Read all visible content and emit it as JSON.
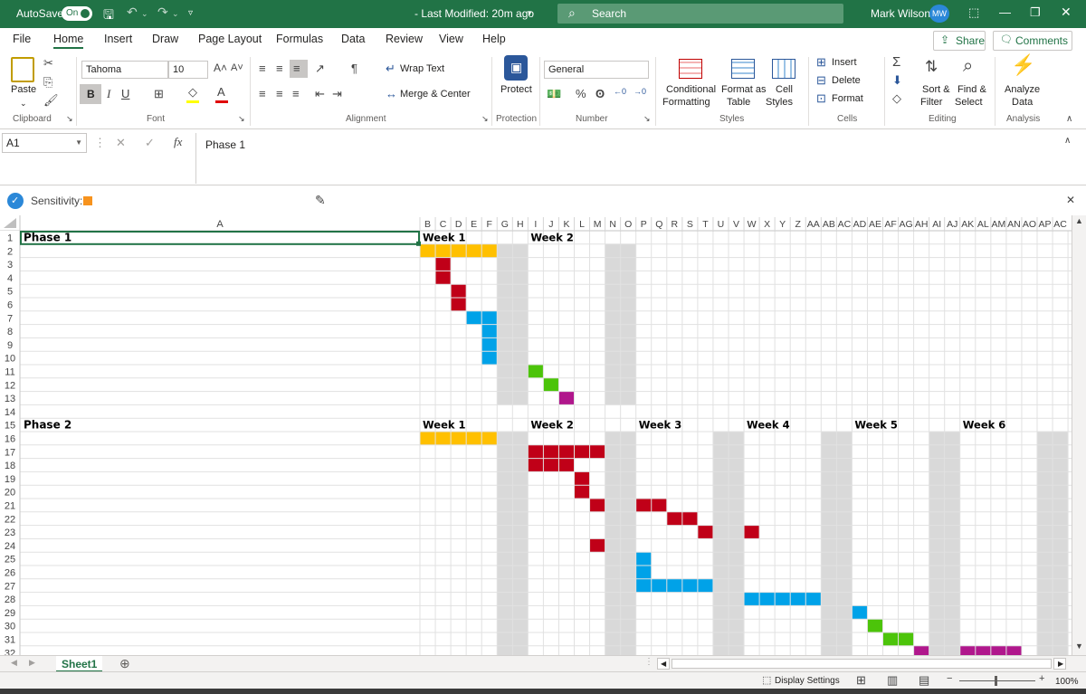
{
  "titlebar": {
    "autosave_label": "AutoSave",
    "autosave_state": "On",
    "doc_status": "- Last Modified: 20m ago",
    "search_placeholder": "Search",
    "user_name": "Mark Wilson",
    "user_initials": "MW"
  },
  "tabs": [
    "File",
    "Home",
    "Insert",
    "Draw",
    "Page Layout",
    "Formulas",
    "Data",
    "Review",
    "View",
    "Help"
  ],
  "active_tab": "Home",
  "share_label": "Share",
  "comments_label": "Comments",
  "ribbon": {
    "paste_label": "Paste",
    "clipboard_label": "Clipboard",
    "font_name": "Tahoma",
    "font_size": "10",
    "font_label": "Font",
    "wrap_text": "Wrap Text",
    "merge_center": "Merge & Center",
    "alignment_label": "Alignment",
    "protect_label": "Protect",
    "protection_label": "Protection",
    "number_format": "General",
    "number_label": "Number",
    "conditional_formatting_1": "Conditional",
    "conditional_formatting_2": "Formatting",
    "format_as_table_1": "Format as",
    "format_as_table_2": "Table",
    "cell_styles_1": "Cell",
    "cell_styles_2": "Styles",
    "styles_label": "Styles",
    "insert": "Insert",
    "delete": "Delete",
    "format": "Format",
    "cells_label": "Cells",
    "sort_filter_1": "Sort &",
    "sort_filter_2": "Filter",
    "find_select_1": "Find &",
    "find_select_2": "Select",
    "editing_label": "Editing",
    "analyze_1": "Analyze",
    "analyze_2": "Data",
    "analysis_label": "Analysis"
  },
  "formula_bar": {
    "name_box": "A1",
    "fx": "fx",
    "content": "Phase 1"
  },
  "sensitivity_label": "Sensitivity:",
  "colors": {
    "excel_green": "#217346",
    "yellow": "#FFC000",
    "red": "#C00018",
    "blue": "#00A2E8",
    "green": "#4CC40A",
    "magenta": "#B0178C",
    "weekend_gray": "#D9D9D9"
  },
  "sheet": {
    "column_headers": [
      "A",
      "B",
      "C",
      "D",
      "E",
      "F",
      "G",
      "H",
      "I",
      "J",
      "K",
      "L",
      "M",
      "N",
      "O",
      "P",
      "Q",
      "R",
      "S",
      "T",
      "U",
      "V",
      "W",
      "X",
      "Y",
      "Z",
      "AA",
      "AB",
      "AC",
      "AD",
      "AE",
      "AF",
      "AG",
      "AH",
      "AI",
      "AJ",
      "AK",
      "AL",
      "AM",
      "AN",
      "AO",
      "AP",
      "AC"
    ],
    "row_numbers": [
      "1",
      "2",
      "3",
      "4",
      "5",
      "6",
      "7",
      "8",
      "9",
      "10",
      "11",
      "12",
      "13",
      "14",
      "15",
      "16",
      "17",
      "18",
      "19",
      "20",
      "21",
      "22",
      "23",
      "24",
      "25",
      "26",
      "27",
      "28",
      "29",
      "30",
      "31",
      "32"
    ],
    "phase1_label": "Phase 1",
    "phase2_label": "Phase 2",
    "phase1_weeks": [
      "Week 1",
      "Week 2"
    ],
    "phase2_weeks": [
      "Week 1",
      "Week 2",
      "Week 3",
      "Week 4",
      "Week 5",
      "Week 6"
    ]
  },
  "sheet_tab": "Sheet1",
  "status": {
    "display_settings": "Display Settings",
    "zoom": "100%"
  },
  "gantt": {
    "phase1": [
      {
        "row": 2,
        "start": 0,
        "len": 5,
        "color": "yellow"
      },
      {
        "row": 3,
        "start": 1,
        "len": 1,
        "color": "red"
      },
      {
        "row": 4,
        "start": 1,
        "len": 1,
        "color": "red"
      },
      {
        "row": 5,
        "start": 2,
        "len": 1,
        "color": "red"
      },
      {
        "row": 6,
        "start": 2,
        "len": 1,
        "color": "red"
      },
      {
        "row": 7,
        "start": 3,
        "len": 2,
        "color": "blue"
      },
      {
        "row": 8,
        "start": 4,
        "len": 1,
        "color": "blue"
      },
      {
        "row": 9,
        "start": 4,
        "len": 1,
        "color": "blue"
      },
      {
        "row": 10,
        "start": 4,
        "len": 1,
        "color": "blue"
      },
      {
        "row": 11,
        "start": 7,
        "len": 1,
        "color": "green"
      },
      {
        "row": 12,
        "start": 8,
        "len": 1,
        "color": "green"
      },
      {
        "row": 13,
        "start": 9,
        "len": 1,
        "color": "magenta"
      }
    ],
    "phase2": [
      {
        "row": 16,
        "start": 0,
        "len": 5,
        "color": "yellow"
      },
      {
        "row": 17,
        "start": 7,
        "len": 5,
        "color": "red"
      },
      {
        "row": 18,
        "start": 7,
        "len": 3,
        "color": "red"
      },
      {
        "row": 19,
        "start": 10,
        "len": 1,
        "color": "red"
      },
      {
        "row": 20,
        "start": 10,
        "len": 1,
        "color": "red"
      },
      {
        "row": 21,
        "start": 11,
        "len": 1,
        "color": "red"
      },
      {
        "row": 21,
        "start": 14,
        "len": 2,
        "color": "red"
      },
      {
        "row": 22,
        "start": 16,
        "len": 2,
        "color": "red"
      },
      {
        "row": 23,
        "start": 18,
        "len": 1,
        "color": "red"
      },
      {
        "row": 23,
        "start": 21,
        "len": 1,
        "color": "red"
      },
      {
        "row": 24,
        "start": 11,
        "len": 1,
        "color": "red"
      },
      {
        "row": 25,
        "start": 14,
        "len": 1,
        "color": "blue"
      },
      {
        "row": 26,
        "start": 14,
        "len": 1,
        "color": "blue"
      },
      {
        "row": 27,
        "start": 14,
        "len": 5,
        "color": "blue"
      },
      {
        "row": 28,
        "start": 21,
        "len": 5,
        "color": "blue"
      },
      {
        "row": 29,
        "start": 28,
        "len": 1,
        "color": "blue"
      },
      {
        "row": 30,
        "start": 29,
        "len": 1,
        "color": "green"
      },
      {
        "row": 31,
        "start": 30,
        "len": 2,
        "color": "green"
      },
      {
        "row": 32,
        "start": 32,
        "len": 1,
        "color": "magenta"
      },
      {
        "row": 32,
        "start": 35,
        "len": 4,
        "color": "magenta"
      }
    ],
    "weekend_cols": [
      5,
      6,
      12,
      13,
      19,
      20,
      26,
      27,
      33,
      34,
      40,
      41
    ]
  }
}
